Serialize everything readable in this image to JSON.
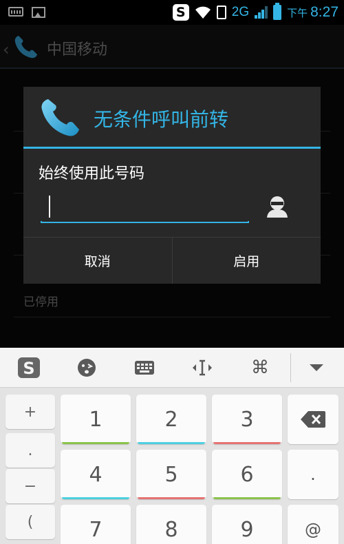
{
  "status_bar": {
    "network": "2G",
    "ampm": "下午",
    "time": "8:27",
    "icons": [
      "keyboard-icon",
      "image-icon",
      "sogou-icon",
      "wifi-icon",
      "sim-icon",
      "signal-icon",
      "battery-icon"
    ]
  },
  "action_bar": {
    "title": "中国移动"
  },
  "background": {
    "status_text": "已停用"
  },
  "dialog": {
    "title": "无条件呼叫前转",
    "label": "始终使用此号码",
    "input_value": "",
    "cancel_label": "取消",
    "enable_label": "启用"
  },
  "keyboard": {
    "toolbar_icons": [
      "sogou-logo-icon",
      "emoji-icon",
      "keyboard-icon",
      "cursor-move-icon",
      "command-icon",
      "collapse-icon"
    ],
    "side_keys": [
      "+",
      ".",
      "−",
      "("
    ],
    "rows": [
      [
        "1",
        "2",
        "3"
      ],
      [
        "4",
        "5",
        "6"
      ],
      [
        "7",
        "8",
        "9"
      ]
    ],
    "right_keys": [
      "",
      ".",
      "@"
    ],
    "underline_colors": {
      "green": "#8bc34a",
      "teal": "#4dd0e1",
      "red": "#e57373"
    }
  },
  "colors": {
    "accent": "#33b5e5",
    "dialog_bg": "#282828"
  }
}
